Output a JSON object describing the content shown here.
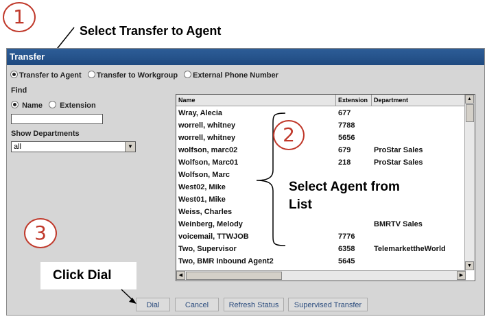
{
  "annotations": {
    "step1": {
      "number": "1",
      "text": "Select Transfer to Agent"
    },
    "step2": {
      "number": "2",
      "text": "Select Agent from List"
    },
    "step3": {
      "number": "3",
      "text": "Click Dial"
    }
  },
  "dialog": {
    "title": "Transfer",
    "transfer_options": [
      {
        "label": "Transfer to Agent",
        "selected": true
      },
      {
        "label": "Transfer to Workgroup",
        "selected": false
      },
      {
        "label": "External Phone Number",
        "selected": false
      }
    ],
    "find": {
      "label": "Find",
      "options": [
        {
          "label": "Name",
          "selected": true
        },
        {
          "label": "Extension",
          "selected": false
        }
      ],
      "value": ""
    },
    "show_departments": {
      "label": "Show Departments",
      "selected": "all"
    },
    "agent_list": {
      "columns": [
        "Name",
        "Extension",
        "Department"
      ],
      "rows": [
        {
          "name": "Wray, Alecia",
          "extension": "677",
          "department": ""
        },
        {
          "name": "worrell, whitney",
          "extension": "7788",
          "department": ""
        },
        {
          "name": "worrell, whitney",
          "extension": "5656",
          "department": ""
        },
        {
          "name": "wolfson, marc02",
          "extension": "679",
          "department": "ProStar Sales"
        },
        {
          "name": "Wolfson, Marc01",
          "extension": "218",
          "department": "ProStar Sales"
        },
        {
          "name": "Wolfson, Marc",
          "extension": "",
          "department": ""
        },
        {
          "name": "West02, Mike",
          "extension": "",
          "department": ""
        },
        {
          "name": "West01, Mike",
          "extension": "",
          "department": ""
        },
        {
          "name": "Weiss, Charles",
          "extension": "",
          "department": ""
        },
        {
          "name": "Weinberg, Melody",
          "extension": "",
          "department": "BMRTV Sales"
        },
        {
          "name": "voicemail, TTWJOB",
          "extension": "7776",
          "department": ""
        },
        {
          "name": "Two, Supervisor",
          "extension": "6358",
          "department": "TelemarkettheWorld"
        },
        {
          "name": "Two, BMR Inbound Agent2",
          "extension": "5645",
          "department": ""
        }
      ]
    },
    "buttons": [
      "Dial",
      "Cancel",
      "Refresh Status",
      "Supervised Transfer"
    ]
  }
}
